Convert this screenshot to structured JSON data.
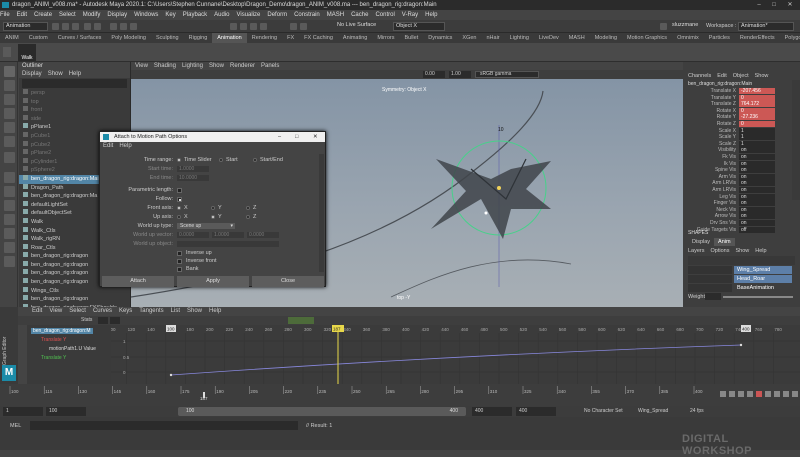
{
  "window": {
    "title": "dragon_ANIM_v008.ma* - Autodesk Maya 2020.1: C:\\Users\\Stephen Cunnane\\Desktop\\Dragon_Demo\\dragon_ANIM_v008.ma  ---  ben_dragon_rig:dragon:Main",
    "workspace_label": "Workspace :",
    "workspace_value": "Animation*"
  },
  "main_menu": [
    "File",
    "Edit",
    "Create",
    "Select",
    "Modify",
    "Display",
    "Windows",
    "Key",
    "Playback",
    "Audio",
    "Visualize",
    "Deform",
    "Constrain",
    "MASH",
    "Cache",
    "Control",
    "V-Ray",
    "Help"
  ],
  "status_line": {
    "mode": "Animation",
    "no_live_surface": "No Live Surface",
    "symmetry": "Object X",
    "user": "sluzzmane"
  },
  "shelf_tabs": [
    "ANIM",
    "Custom",
    "Curves / Surfaces",
    "Poly Modeling",
    "Sculpting",
    "Rigging",
    "Animation",
    "Rendering",
    "FX",
    "FX Caching",
    "Animating",
    "Mirrors",
    "Bullet",
    "Dynamics",
    "XGen",
    "nHair",
    "Lighting",
    "LiveDev",
    "MASH",
    "Modeling",
    "Motion Graphics",
    "Omnimix",
    "Particles",
    "RenderEffects",
    "Polygons_User",
    "Scripting",
    "VRay",
    "XGen_User"
  ],
  "shelf_button_label": "Walk",
  "outliner": {
    "title": "Outliner",
    "menu": [
      "Display",
      "Show",
      "Help"
    ],
    "items": [
      {
        "label": "persp",
        "dim": true
      },
      {
        "label": "top",
        "dim": true
      },
      {
        "label": "front",
        "dim": true
      },
      {
        "label": "side",
        "dim": true
      },
      {
        "label": "pPlane1",
        "dim": false
      },
      {
        "label": "pCube1",
        "dim": true
      },
      {
        "label": "pCube2",
        "dim": true
      },
      {
        "label": "pPlane2",
        "dim": true
      },
      {
        "label": "pCylinder1",
        "dim": true
      },
      {
        "label": "pSphere2",
        "dim": true
      },
      {
        "label": "ben_dragon_rig:dragon:Main",
        "dim": false,
        "sel": true
      },
      {
        "label": "Dragon_Path",
        "dim": false
      },
      {
        "label": "ben_dragon_rig:dragon:Ma",
        "dim": false
      },
      {
        "label": "defaultLightSet",
        "dim": false
      },
      {
        "label": "defaultObjectSet",
        "dim": false
      },
      {
        "label": "Walk",
        "dim": false
      },
      {
        "label": "Walk_Ctls",
        "dim": false
      },
      {
        "label": "Walk_rigRN",
        "dim": false
      },
      {
        "label": "Roar_Ctls",
        "dim": false
      },
      {
        "label": "ben_dragon_rig:dragon",
        "dim": false
      },
      {
        "label": "ben_dragon_rig:dragon",
        "dim": false
      },
      {
        "label": "ben_dragon_rig:dragon",
        "dim": false
      },
      {
        "label": "ben_dragon_rig:dragon",
        "dim": false
      },
      {
        "label": "Wings_Ctls",
        "dim": false
      },
      {
        "label": "ben_dragon_rig:dragon",
        "dim": false
      },
      {
        "label": "ben_dragon_rig:dragon:FKShoulde",
        "dim": false
      }
    ]
  },
  "viewport": {
    "menu": [
      "View",
      "Shading",
      "Lighting",
      "Show",
      "Renderer",
      "Panels"
    ],
    "symmetry_label": "Symmetry: Object X",
    "camera_label": "top -Y",
    "colorspace": "sRGB gamma",
    "value_a": "0.00",
    "value_b": "1.00"
  },
  "dialog": {
    "title": "Attach to Motion Path Options",
    "menu": [
      "Edit",
      "Help"
    ],
    "time_range_label": "Time range:",
    "time_range_options": [
      "Time Slider",
      "Start",
      "Start/End"
    ],
    "start_time_label": "Start time:",
    "start_time_value": "1.0000",
    "end_time_label": "End time:",
    "end_time_value": "10.0000",
    "parametric_length_label": "Parametric length:",
    "follow_label": "Follow:",
    "front_axis_label": "Front axis:",
    "up_axis_label": "Up axis:",
    "axes": [
      "X",
      "Y",
      "Z"
    ],
    "world_up_type_label": "World up type:",
    "world_up_type_value": "Scene up",
    "world_up_vector_label": "World up vector:",
    "world_up_vector": [
      "0.0000",
      "1.0000",
      "0.0000"
    ],
    "world_up_object_label": "World up object:",
    "inverse_up": "Inverse up",
    "inverse_front": "Inverse front",
    "bank": "Bank",
    "buttons": {
      "attach": "Attach",
      "apply": "Apply",
      "close": "Close"
    }
  },
  "channel_box": {
    "menu": [
      "Channels",
      "Edit",
      "Object",
      "Show"
    ],
    "object": "ben_dragon_rig:dragon:Main",
    "channels": [
      {
        "name": "Translate X",
        "value": "-207.456",
        "key": true
      },
      {
        "name": "Translate Y",
        "value": "0",
        "key": true
      },
      {
        "name": "Translate Z",
        "value": "764.172",
        "key": true
      },
      {
        "name": "Rotate X",
        "value": "0",
        "key": true
      },
      {
        "name": "Rotate Y",
        "value": "-27.236",
        "key": true
      },
      {
        "name": "Rotate Z",
        "value": "0",
        "key": true
      },
      {
        "name": "Scale X",
        "value": "1",
        "key": false
      },
      {
        "name": "Scale Y",
        "value": "1",
        "key": false
      },
      {
        "name": "Scale Z",
        "value": "1",
        "key": false
      },
      {
        "name": "Visibility",
        "value": "on",
        "key": false
      },
      {
        "name": "Fk Vis",
        "value": "on",
        "key": false
      },
      {
        "name": "Ik Vis",
        "value": "on",
        "key": false
      },
      {
        "name": "Spine Vis",
        "value": "on",
        "key": false
      },
      {
        "name": "Arm Vis",
        "value": "on",
        "key": false
      },
      {
        "name": "Arm LRVis",
        "value": "on",
        "key": false
      },
      {
        "name": "Arm LRVis",
        "value": "on",
        "key": false
      },
      {
        "name": "Leg Vis",
        "value": "on",
        "key": false
      },
      {
        "name": "Finger Vis",
        "value": "on",
        "key": false
      },
      {
        "name": "Neck Vis",
        "value": "on",
        "key": false
      },
      {
        "name": "Arrow Vis",
        "value": "on",
        "key": false
      },
      {
        "name": "Drv Sns Vis",
        "value": "on",
        "key": false
      },
      {
        "name": "Guide Targets Vis",
        "value": "off",
        "key": false
      }
    ],
    "shapes_label": "SHAPES",
    "layer_tabs": [
      "Display",
      "Anim"
    ],
    "layer_menu": [
      "Layers",
      "Options",
      "Show",
      "Help"
    ],
    "layers": [
      "Wing_Spread",
      "Head_Roar",
      "BaseAnimation"
    ],
    "weight_label": "Weight",
    "weight_value": "1.000"
  },
  "graph_editor": {
    "side_label": "Graph Editor",
    "menu": [
      "Edit",
      "View",
      "Select",
      "Curves",
      "Keys",
      "Tangents",
      "List",
      "Show",
      "Help"
    ],
    "stats_label": "Stats",
    "list": [
      "ben_dragon_rig:dragon:M",
      "Translate Y",
      "motionPath1.U Value",
      "Translate Y"
    ],
    "y_ticks": [
      "1",
      "0.5",
      "0"
    ],
    "x_ticks": [
      "100",
      "120",
      "140",
      "160",
      "180",
      "200",
      "220",
      "240",
      "260",
      "280",
      "300",
      "320",
      "340",
      "360",
      "380",
      "400",
      "420",
      "440",
      "460",
      "480",
      "500",
      "520",
      "540",
      "560",
      "580",
      "600",
      "620",
      "640",
      "660",
      "680",
      "700",
      "720",
      "740",
      "760",
      "780"
    ],
    "current_frame": "187",
    "frame_start_marker": "100",
    "frame_end_marker": "400"
  },
  "time_slider": {
    "ticks": [
      "100",
      "115",
      "130",
      "145",
      "160",
      "175",
      "190",
      "205",
      "220",
      "235",
      "250",
      "265",
      "280",
      "295",
      "310",
      "325",
      "340",
      "355",
      "370",
      "385",
      "400"
    ],
    "current_frame": "187",
    "frame_field": "1",
    "range_start": "1",
    "range_inner_start": "100",
    "range_inner_end": "400",
    "range_end": "400",
    "range_max": "400",
    "character_set": "No Character Set",
    "anim_layer": "Wing_Spread",
    "fps": "24 fps"
  },
  "command_line": {
    "lang": "MEL",
    "result": "// Result: 1"
  },
  "watermark": "DIGITAL WORKSHOP"
}
